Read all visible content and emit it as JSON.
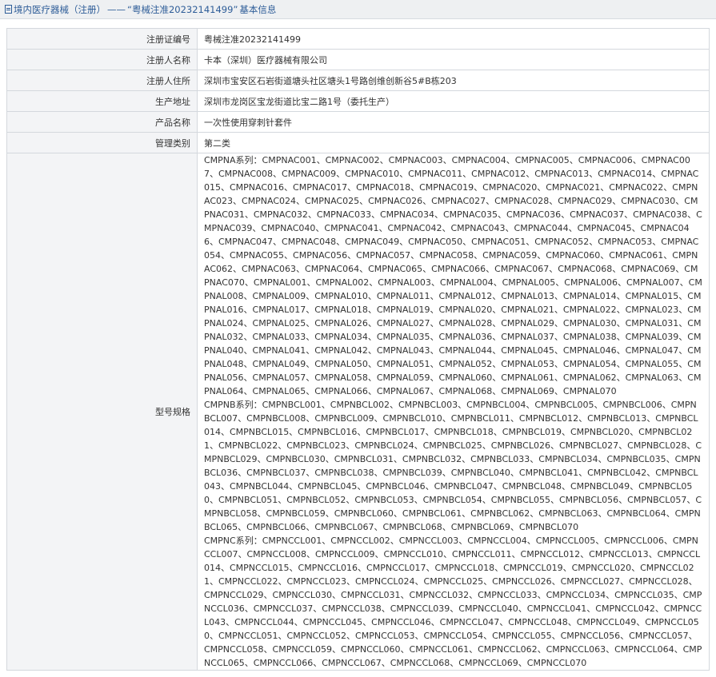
{
  "header": {
    "category": "境内医疗器械（注册）",
    "dash": "——",
    "record": "“粤械注准20232141499”",
    "suffix": "基本信息"
  },
  "fields": [
    {
      "label": "注册证编号",
      "value": "粤械注准20232141499"
    },
    {
      "label": "注册人名称",
      "value": "卡本（深圳）医疗器械有限公司"
    },
    {
      "label": "注册人住所",
      "value": "深圳市宝安区石岩街道塘头社区塘头1号路创维创新谷5#B栋203"
    },
    {
      "label": "生产地址",
      "value": "深圳市龙岗区宝龙街道比宝二路1号（委托生产）"
    },
    {
      "label": "产品名称",
      "value": "一次性使用穿刺针套件"
    },
    {
      "label": "管理类别",
      "value": "第二类"
    }
  ],
  "models": {
    "label": "型号规格",
    "series": [
      {
        "text": "CMPNA系列：CMPNAC001、CMPNAC002、CMPNAC003、CMPNAC004、CMPNAC005、CMPNAC006、CMPNAC007、CMPNAC008、CMPNAC009、CMPNAC010、CMPNAC011、CMPNAC012、CMPNAC013、CMPNAC014、CMPNAC015、CMPNAC016、CMPNAC017、CMPNAC018、CMPNAC019、CMPNAC020、CMPNAC021、CMPNAC022、CMPNAC023、CMPNAC024、CMPNAC025、CMPNAC026、CMPNAC027、CMPNAC028、CMPNAC029、CMPNAC030、CMPNAC031、CMPNAC032、CMPNAC033、CMPNAC034、CMPNAC035、CMPNAC036、CMPNAC037、CMPNAC038、CMPNAC039、CMPNAC040、CMPNAC041、CMPNAC042、CMPNAC043、CMPNAC044、CMPNAC045、CMPNAC046、CMPNAC047、CMPNAC048、CMPNAC049、CMPNAC050、CMPNAC051、CMPNAC052、CMPNAC053、CMPNAC054、CMPNAC055、CMPNAC056、CMPNAC057、CMPNAC058、CMPNAC059、CMPNAC060、CMPNAC061、CMPNAC062、CMPNAC063、CMPNAC064、CMPNAC065、CMPNAC066、CMPNAC067、CMPNAC068、CMPNAC069、CMPNAC070、CMPNAL001、CMPNAL002、CMPNAL003、CMPNAL004、CMPNAL005、CMPNAL006、CMPNAL007、CMPNAL008、CMPNAL009、CMPNAL010、CMPNAL011、CMPNAL012、CMPNAL013、CMPNAL014、CMPNAL015、CMPNAL016、CMPNAL017、CMPNAL018、CMPNAL019、CMPNAL020、CMPNAL021、CMPNAL022、CMPNAL023、CMPNAL024、CMPNAL025、CMPNAL026、CMPNAL027、CMPNAL028、CMPNAL029、CMPNAL030、CMPNAL031、CMPNAL032、CMPNAL033、CMPNAL034、CMPNAL035、CMPNAL036、CMPNAL037、CMPNAL038、CMPNAL039、CMPNAL040、CMPNAL041、CMPNAL042、CMPNAL043、CMPNAL044、CMPNAL045、CMPNAL046、CMPNAL047、CMPNAL048、CMPNAL049、CMPNAL050、CMPNAL051、CMPNAL052、CMPNAL053、CMPNAL054、CMPNAL055、CMPNAL056、CMPNAL057、CMPNAL058、CMPNAL059、CMPNAL060、CMPNAL061、CMPNAL062、CMPNAL063、CMPNAL064、CMPNAL065、CMPNAL066、CMPNAL067、CMPNAL068、CMPNAL069、CMPNAL070"
      },
      {
        "text": "CMPNB系列：CMPNBCL001、CMPNBCL002、CMPNBCL003、CMPNBCL004、CMPNBCL005、CMPNBCL006、CMPNBCL007、CMPNBCL008、CMPNBCL009、CMPNBCL010、CMPNBCL011、CMPNBCL012、CMPNBCL013、CMPNBCL014、CMPNBCL015、CMPNBCL016、CMPNBCL017、CMPNBCL018、CMPNBCL019、CMPNBCL020、CMPNBCL021、CMPNBCL022、CMPNBCL023、CMPNBCL024、CMPNBCL025、CMPNBCL026、CMPNBCL027、CMPNBCL028、CMPNBCL029、CMPNBCL030、CMPNBCL031、CMPNBCL032、CMPNBCL033、CMPNBCL034、CMPNBCL035、CMPNBCL036、CMPNBCL037、CMPNBCL038、CMPNBCL039、CMPNBCL040、CMPNBCL041、CMPNBCL042、CMPNBCL043、CMPNBCL044、CMPNBCL045、CMPNBCL046、CMPNBCL047、CMPNBCL048、CMPNBCL049、CMPNBCL050、CMPNBCL051、CMPNBCL052、CMPNBCL053、CMPNBCL054、CMPNBCL055、CMPNBCL056、CMPNBCL057、CMPNBCL058、CMPNBCL059、CMPNBCL060、CMPNBCL061、CMPNBCL062、CMPNBCL063、CMPNBCL064、CMPNBCL065、CMPNBCL066、CMPNBCL067、CMPNBCL068、CMPNBCL069、CMPNBCL070"
      },
      {
        "text": "CMPNC系列：CMPNCCL001、CMPNCCL002、CMPNCCL003、CMPNCCL004、CMPNCCL005、CMPNCCL006、CMPNCCL007、CMPNCCL008、CMPNCCL009、CMPNCCL010、CMPNCCL011、CMPNCCL012、CMPNCCL013、CMPNCCL014、CMPNCCL015、CMPNCCL016、CMPNCCL017、CMPNCCL018、CMPNCCL019、CMPNCCL020、CMPNCCL021、CMPNCCL022、CMPNCCL023、CMPNCCL024、CMPNCCL025、CMPNCCL026、CMPNCCL027、CMPNCCL028、CMPNCCL029、CMPNCCL030、CMPNCCL031、CMPNCCL032、CMPNCCL033、CMPNCCL034、CMPNCCL035、CMPNCCL036、CMPNCCL037、CMPNCCL038、CMPNCCL039、CMPNCCL040、CMPNCCL041、CMPNCCL042、CMPNCCL043、CMPNCCL044、CMPNCCL045、CMPNCCL046、CMPNCCL047、CMPNCCL048、CMPNCCL049、CMPNCCL050、CMPNCCL051、CMPNCCL052、CMPNCCL053、CMPNCCL054、CMPNCCL055、CMPNCCL056、CMPNCCL057、CMPNCCL058、CMPNCCL059、CMPNCCL060、CMPNCCL061、CMPNCCL062、CMPNCCL063、CMPNCCL064、CMPNCCL065、CMPNCCL066、CMPNCCL067、CMPNCCL068、CMPNCCL069、CMPNCCL070"
      }
    ]
  },
  "colors": {
    "title_text": "#2e5d98",
    "title_bg": "#eef0f2",
    "label_bg": "#f3f4f6",
    "border": "#d4d8dd"
  },
  "icons": {
    "title": "document-icon"
  }
}
